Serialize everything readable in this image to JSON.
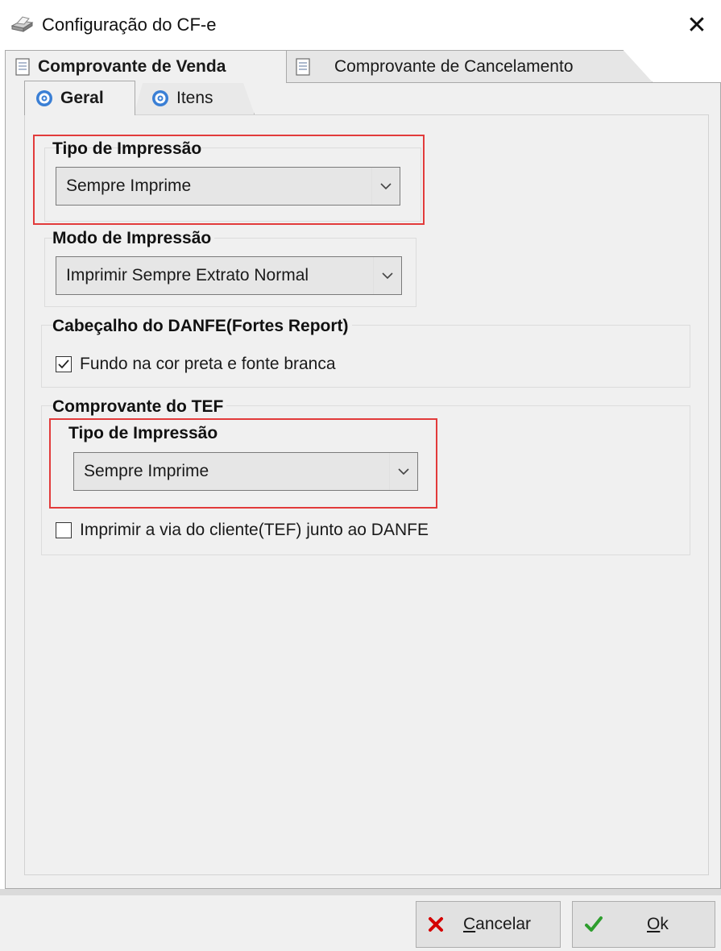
{
  "window": {
    "title": "Configuração do CF-e",
    "title_icon": "printer-icon",
    "close_glyph": "✕"
  },
  "tabs_main": [
    {
      "label": "Comprovante de Venda",
      "icon": "document-icon",
      "active": true
    },
    {
      "label": "Comprovante de Cancelamento",
      "icon": "document-icon",
      "active": false
    }
  ],
  "tabs_sub": [
    {
      "label": "Geral",
      "icon": "gear-icon",
      "active": true
    },
    {
      "label": "Itens",
      "icon": "gear-icon",
      "active": false
    }
  ],
  "tipo_impressao": {
    "label": "Tipo de Impressão",
    "value": "Sempre Imprime"
  },
  "modo_impressao": {
    "label": "Modo de Impressão",
    "value": "Imprimir Sempre Extrato Normal"
  },
  "cabecalho": {
    "label": "Cabeçalho do DANFE(Fortes Report)",
    "checkbox_label": "Fundo na cor preta e fonte branca",
    "checked": true
  },
  "tef": {
    "label": "Comprovante do TEF",
    "tipo_label": "Tipo de Impressão",
    "tipo_value": "Sempre Imprime",
    "checkbox_label": "Imprimir a via do cliente(TEF) junto ao DANFE",
    "checked": false
  },
  "buttons": {
    "cancel": {
      "accel": "C",
      "rest": "ancelar",
      "icon": "red-x-icon"
    },
    "ok": {
      "accel": "O",
      "rest": "k",
      "icon": "green-check-icon"
    }
  },
  "colors": {
    "highlight": "#e23b3b",
    "cancel_icon": "#d40000",
    "ok_icon": "#2e9e2e",
    "gear": "#3a7fd5"
  }
}
